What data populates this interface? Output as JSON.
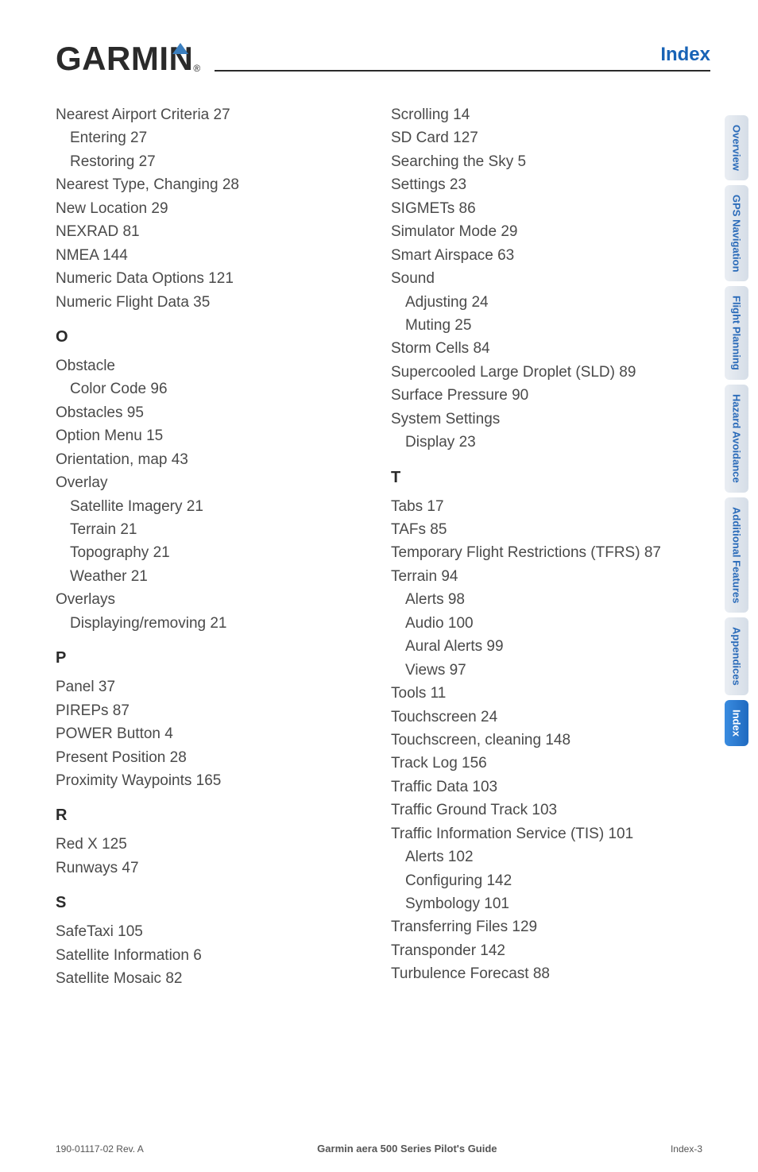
{
  "header": {
    "logo_text": "GARMIN",
    "logo_reg": "®",
    "section_title": "Index"
  },
  "tabs": [
    {
      "label": "Overview"
    },
    {
      "label": "GPS Navigation"
    },
    {
      "label": "Flight Planning"
    },
    {
      "label": "Hazard Avoidance"
    },
    {
      "label": "Additional Features"
    },
    {
      "label": "Appendices"
    },
    {
      "label": "Index",
      "active": true
    }
  ],
  "col1": [
    {
      "t": "Nearest Airport Criteria  27",
      "lvl": 0
    },
    {
      "t": "Entering  27",
      "lvl": 1
    },
    {
      "t": "Restoring  27",
      "lvl": 1
    },
    {
      "t": "Nearest Type, Changing  28",
      "lvl": 0
    },
    {
      "t": "New Location  29",
      "lvl": 0
    },
    {
      "t": "NEXRAD  81",
      "lvl": 0
    },
    {
      "t": "NMEA  144",
      "lvl": 0
    },
    {
      "t": "Numeric Data Options  121",
      "lvl": 0
    },
    {
      "t": "Numeric Flight Data  35",
      "lvl": 0
    },
    {
      "heading": "O"
    },
    {
      "t": "Obstacle",
      "lvl": 0
    },
    {
      "t": "Color Code  96",
      "lvl": 1
    },
    {
      "t": "Obstacles  95",
      "lvl": 0
    },
    {
      "t": "Option Menu  15",
      "lvl": 0
    },
    {
      "t": "Orientation, map  43",
      "lvl": 0
    },
    {
      "t": "Overlay",
      "lvl": 0
    },
    {
      "t": "Satellite Imagery  21",
      "lvl": 1
    },
    {
      "t": "Terrain  21",
      "lvl": 1
    },
    {
      "t": "Topography  21",
      "lvl": 1
    },
    {
      "t": "Weather  21",
      "lvl": 1
    },
    {
      "t": "Overlays",
      "lvl": 0
    },
    {
      "t": "Displaying/removing  21",
      "lvl": 1
    },
    {
      "heading": "P"
    },
    {
      "t": "Panel  37",
      "lvl": 0
    },
    {
      "t": "PIREPs  87",
      "lvl": 0
    },
    {
      "t": "POWER Button  4",
      "lvl": 0
    },
    {
      "t": "Present Position  28",
      "lvl": 0
    },
    {
      "t": "Proximity Waypoints  165",
      "lvl": 0
    },
    {
      "heading": "R"
    },
    {
      "t": "Red X  125",
      "lvl": 0
    },
    {
      "t": "Runways  47",
      "lvl": 0
    },
    {
      "heading": "S"
    },
    {
      "t": "SafeTaxi  105",
      "lvl": 0
    },
    {
      "t": "Satellite Information  6",
      "lvl": 0
    },
    {
      "t": "Satellite Mosaic  82",
      "lvl": 0
    }
  ],
  "col2": [
    {
      "t": "Scrolling  14",
      "lvl": 0
    },
    {
      "t": "SD Card  127",
      "lvl": 0
    },
    {
      "t": "Searching the Sky  5",
      "lvl": 0
    },
    {
      "t": "Settings  23",
      "lvl": 0
    },
    {
      "t": "SIGMETs  86",
      "lvl": 0
    },
    {
      "t": "Simulator Mode  29",
      "lvl": 0
    },
    {
      "t": "Smart Airspace  63",
      "lvl": 0
    },
    {
      "t": "Sound",
      "lvl": 0
    },
    {
      "t": "Adjusting  24",
      "lvl": 1
    },
    {
      "t": "Muting  25",
      "lvl": 1
    },
    {
      "t": "Storm Cells  84",
      "lvl": 0
    },
    {
      "t": "Supercooled Large Droplet (SLD)  89",
      "lvl": 0
    },
    {
      "t": "Surface Pressure  90",
      "lvl": 0
    },
    {
      "t": "System Settings",
      "lvl": 0
    },
    {
      "t": "Display  23",
      "lvl": 1
    },
    {
      "heading": "T"
    },
    {
      "t": "Tabs  17",
      "lvl": 0
    },
    {
      "t": "TAFs  85",
      "lvl": 0
    },
    {
      "t": "Temporary Flight Restrictions (TFRS)  87",
      "lvl": 0
    },
    {
      "t": "Terrain  94",
      "lvl": 0
    },
    {
      "t": "Alerts  98",
      "lvl": 1
    },
    {
      "t": "Audio  100",
      "lvl": 1
    },
    {
      "t": "Aural Alerts  99",
      "lvl": 1
    },
    {
      "t": "Views  97",
      "lvl": 1
    },
    {
      "t": "Tools  11",
      "lvl": 0
    },
    {
      "t": "Touchscreen  24",
      "lvl": 0
    },
    {
      "t": "Touchscreen, cleaning  148",
      "lvl": 0
    },
    {
      "t": "Track Log  156",
      "lvl": 0
    },
    {
      "t": "Traffic Data  103",
      "lvl": 0
    },
    {
      "t": "Traffic Ground Track  103",
      "lvl": 0
    },
    {
      "t": "Traffic Information Service (TIS)  101",
      "lvl": 0
    },
    {
      "t": "Alerts  102",
      "lvl": 1
    },
    {
      "t": "Configuring  142",
      "lvl": 1
    },
    {
      "t": "Symbology  101",
      "lvl": 1
    },
    {
      "t": "Transferring Files  129",
      "lvl": 0
    },
    {
      "t": "Transponder  142",
      "lvl": 0
    },
    {
      "t": "Turbulence Forecast  88",
      "lvl": 0
    }
  ],
  "footer": {
    "left": "190-01117-02 Rev. A",
    "center": "Garmin aera 500 Series Pilot's Guide",
    "right": "Index-3"
  }
}
